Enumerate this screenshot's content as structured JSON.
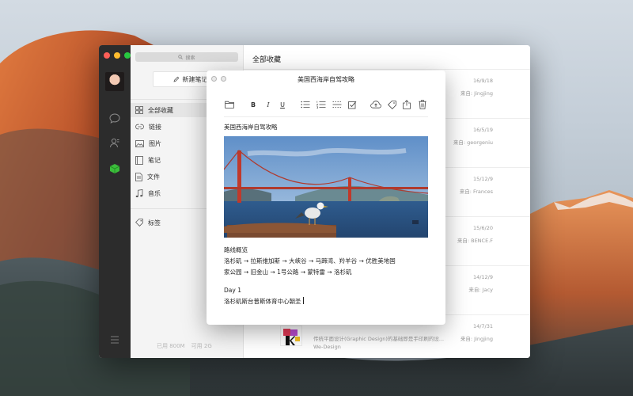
{
  "window": {
    "search_placeholder": "搜索",
    "new_note_label": "新建笔记",
    "list_title": "全部收藏",
    "storage_used": "已用 800M",
    "storage_available": "可用 2G"
  },
  "sidebar": {
    "items": [
      {
        "label": "全部收藏",
        "icon": "grid-icon"
      },
      {
        "label": "链接",
        "icon": "link-icon"
      },
      {
        "label": "图片",
        "icon": "image-icon"
      },
      {
        "label": "笔记",
        "icon": "notebook-icon"
      },
      {
        "label": "文件",
        "icon": "file-icon"
      },
      {
        "label": "音乐",
        "icon": "music-icon"
      }
    ],
    "tags_label": "标签"
  },
  "cards": [
    {
      "date": "16/9/18",
      "source": "来自: Jingjing"
    },
    {
      "date": "16/5/19",
      "source": "来自: georgeniu"
    },
    {
      "date": "15/12/9",
      "source": "来自: Frances"
    },
    {
      "date": "15/6/20",
      "source": "来自: BENCE.F"
    },
    {
      "date": "14/12/9",
      "source": "来自: Jacy"
    },
    {
      "date": "14/7/31",
      "source": "来自: Jingjing",
      "description": "传统平面设计(Graphic Design)的基础即是手印刷的设...",
      "source_line": "We-Design"
    }
  ],
  "editor": {
    "title": "美国西海岸自驾攻略",
    "heading": "美国西海岸自驾攻略",
    "route_title": "路线概览",
    "route_line1": "洛杉矶 → 拉斯维加斯 → 大峡谷 → 马蹄湾、羚羊谷 → 优胜美地国",
    "route_line2": "家公园 → 旧金山 → 1号公路 → 蒙特雷 → 洛杉矶",
    "day_label": "Day 1",
    "day_text": "洛杉矶斯台普斯体育中心朝圣",
    "toolbar": {
      "bold": "B",
      "italic": "I",
      "underline": "U"
    }
  }
}
